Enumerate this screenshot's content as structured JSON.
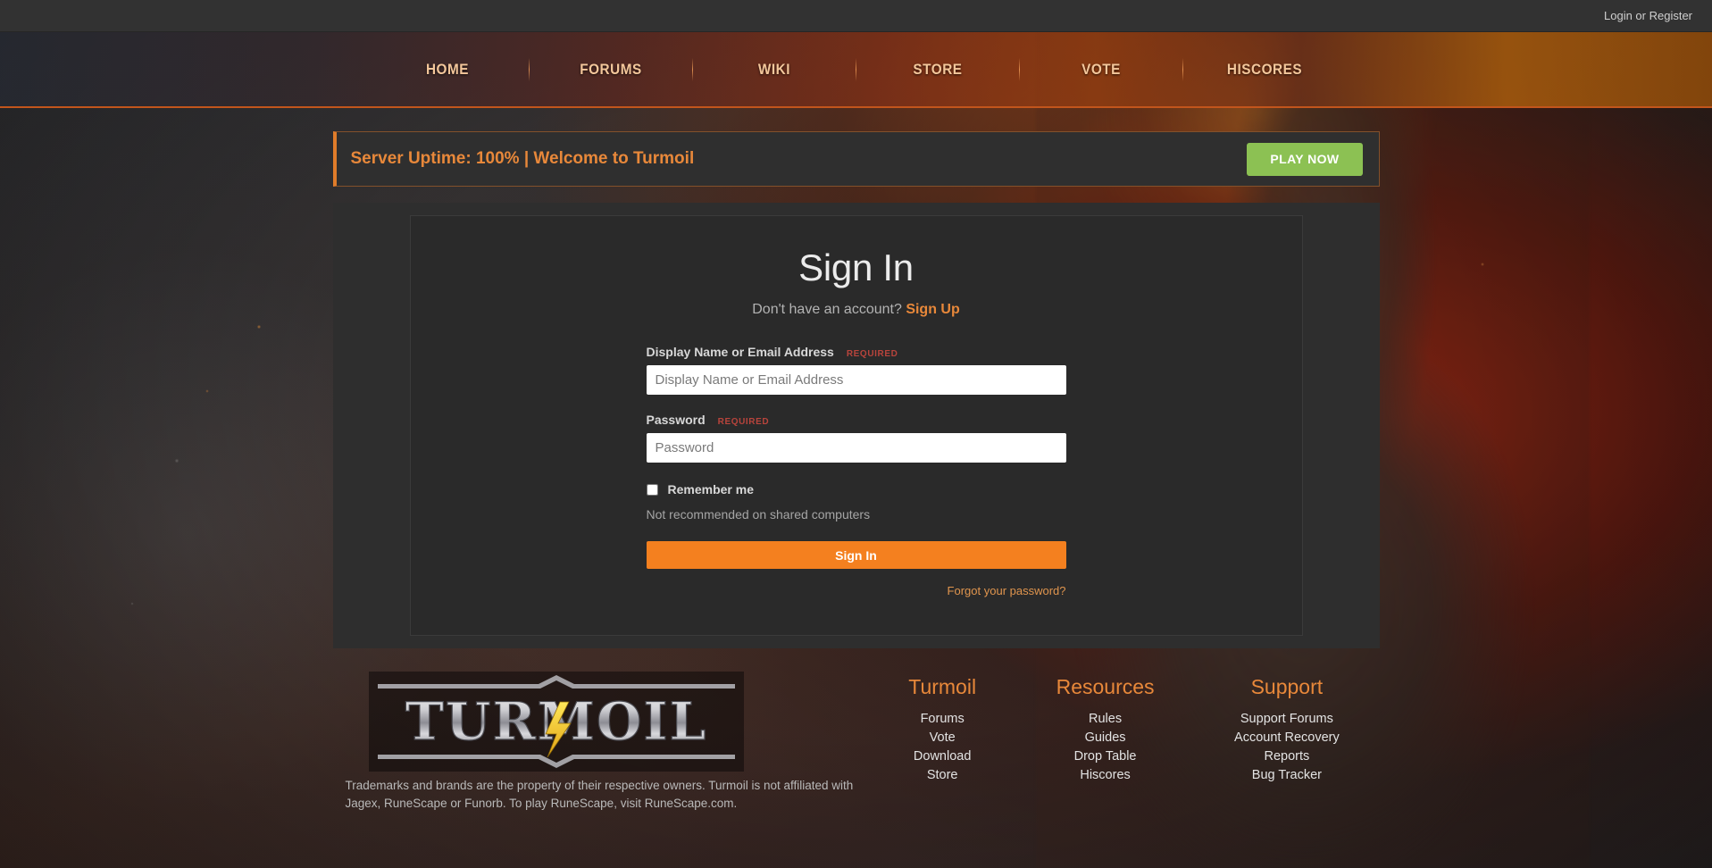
{
  "topbar": {
    "login_register": "Login or Register"
  },
  "nav": {
    "items": [
      {
        "label": "HOME"
      },
      {
        "label": "FORUMS"
      },
      {
        "label": "WIKI"
      },
      {
        "label": "STORE"
      },
      {
        "label": "VOTE"
      },
      {
        "label": "HISCORES"
      }
    ]
  },
  "announcement": {
    "text": "Server Uptime: 100% | Welcome to Turmoil",
    "button": "PLAY NOW",
    "accent_color": "#e07c2a",
    "button_color": "#8cc153"
  },
  "auth": {
    "title": "Sign In",
    "subtitle_prefix": "Don't have an account?",
    "subtitle_link": "Sign Up",
    "username": {
      "label": "Display Name or Email Address",
      "required_badge": "REQUIRED",
      "placeholder": "Display Name or Email Address",
      "value": ""
    },
    "password": {
      "label": "Password",
      "required_badge": "REQUIRED",
      "placeholder": "Password",
      "value": ""
    },
    "remember": {
      "label": "Remember me",
      "hint": "Not recommended on shared computers",
      "checked": false
    },
    "submit": "Sign In",
    "forgot": "Forgot your password?",
    "accent_color": "#f4801f"
  },
  "footer": {
    "logo_text": "TURMOIL",
    "legal": "Trademarks and brands are the property of their respective owners. Turmoil is not affiliated with Jagex, RuneScape or Funorb. To play RuneScape, visit RuneScape.com.",
    "columns": [
      {
        "heading": "Turmoil",
        "links": [
          "Forums",
          "Vote",
          "Download",
          "Store"
        ]
      },
      {
        "heading": "Resources",
        "links": [
          "Rules",
          "Guides",
          "Drop Table",
          "Hiscores"
        ]
      },
      {
        "heading": "Support",
        "links": [
          "Support Forums",
          "Account Recovery",
          "Reports",
          "Bug Tracker"
        ]
      }
    ]
  }
}
